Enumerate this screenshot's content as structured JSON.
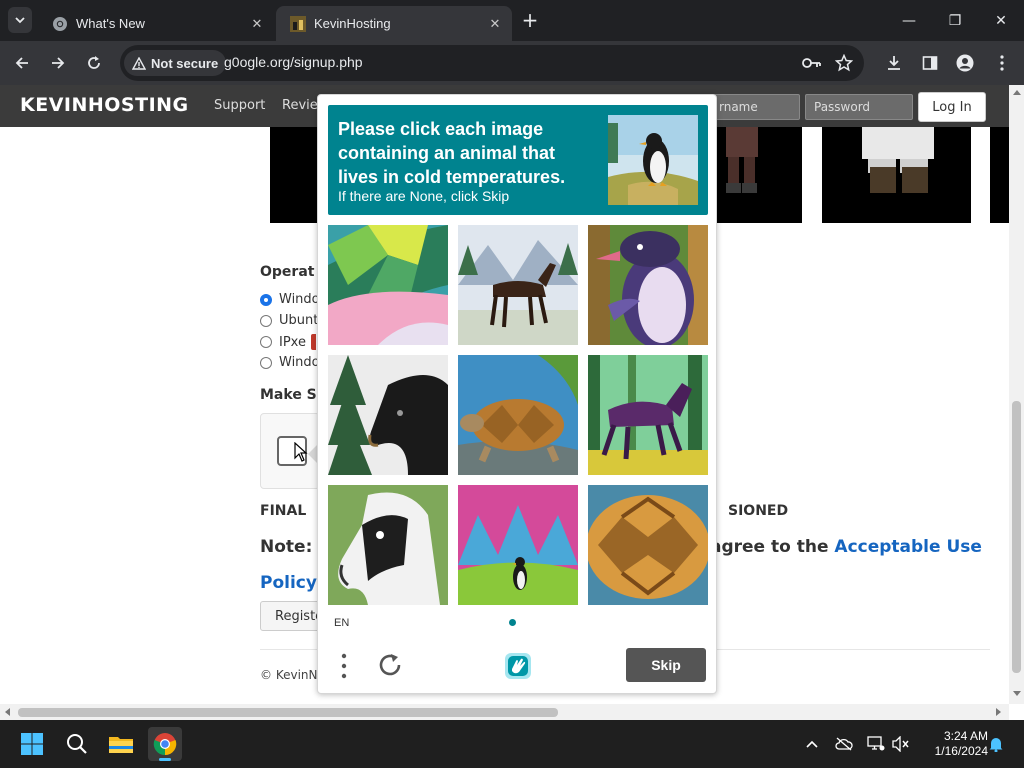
{
  "browser": {
    "tabs": [
      {
        "title": "What's New",
        "favicon": "chrome-icon"
      },
      {
        "title": "KevinHosting",
        "favicon": "kevinhosting-favicon",
        "active": true
      }
    ],
    "close_glyph": "✕",
    "new_tab_glyph": "+",
    "window_controls": {
      "minimize": "—",
      "restore": "❐",
      "close": "✕"
    },
    "security_label": "Not secure",
    "url": "g0ogle.org/signup.php"
  },
  "site": {
    "brand": "KEVINHOSTING",
    "nav": {
      "support": "Support",
      "reviews_partial": "Revie"
    },
    "username_placeholder_partial": "rname",
    "password_placeholder": "Password",
    "login_label": "Log In",
    "os_heading_partial": "Operat",
    "os_options_partial": [
      "Windo",
      "Ubunt",
      "IPxe",
      "Windo"
    ],
    "captcha_heading_partial": "Make S",
    "final_left": "FINAL",
    "final_right": "SIONED",
    "note_left": "Note:",
    "note_right_text": "agree to the ",
    "note_right_link": "Acceptable Use",
    "note_line2_link": "Policy",
    "note_line2_tail": ".",
    "register_partial": "Registe",
    "copyright_partial": "© KevinN"
  },
  "captcha": {
    "prompt": "Please click each image containing an animal that lives in cold temperatures.",
    "subprompt": "If there are None, click Skip",
    "example_image": "penguin-painting",
    "grid": [
      "turtle-shell-closeup",
      "horse-in-mountains",
      "penguin-in-forest",
      "horse-head-by-pine",
      "turtle-on-rock",
      "purple-horse-in-forest",
      "horse-head-portrait",
      "penguin-on-hillside",
      "turtle-closeup"
    ],
    "language": "EN",
    "skip_label": "Skip"
  },
  "taskbar": {
    "time": "3:24 AM",
    "date": "1/16/2024"
  },
  "colors": {
    "captcha_teal": "#00838f",
    "link_blue": "#1565c0",
    "site_nav": "#3b3b3b",
    "chrome_dark": "#202124"
  }
}
